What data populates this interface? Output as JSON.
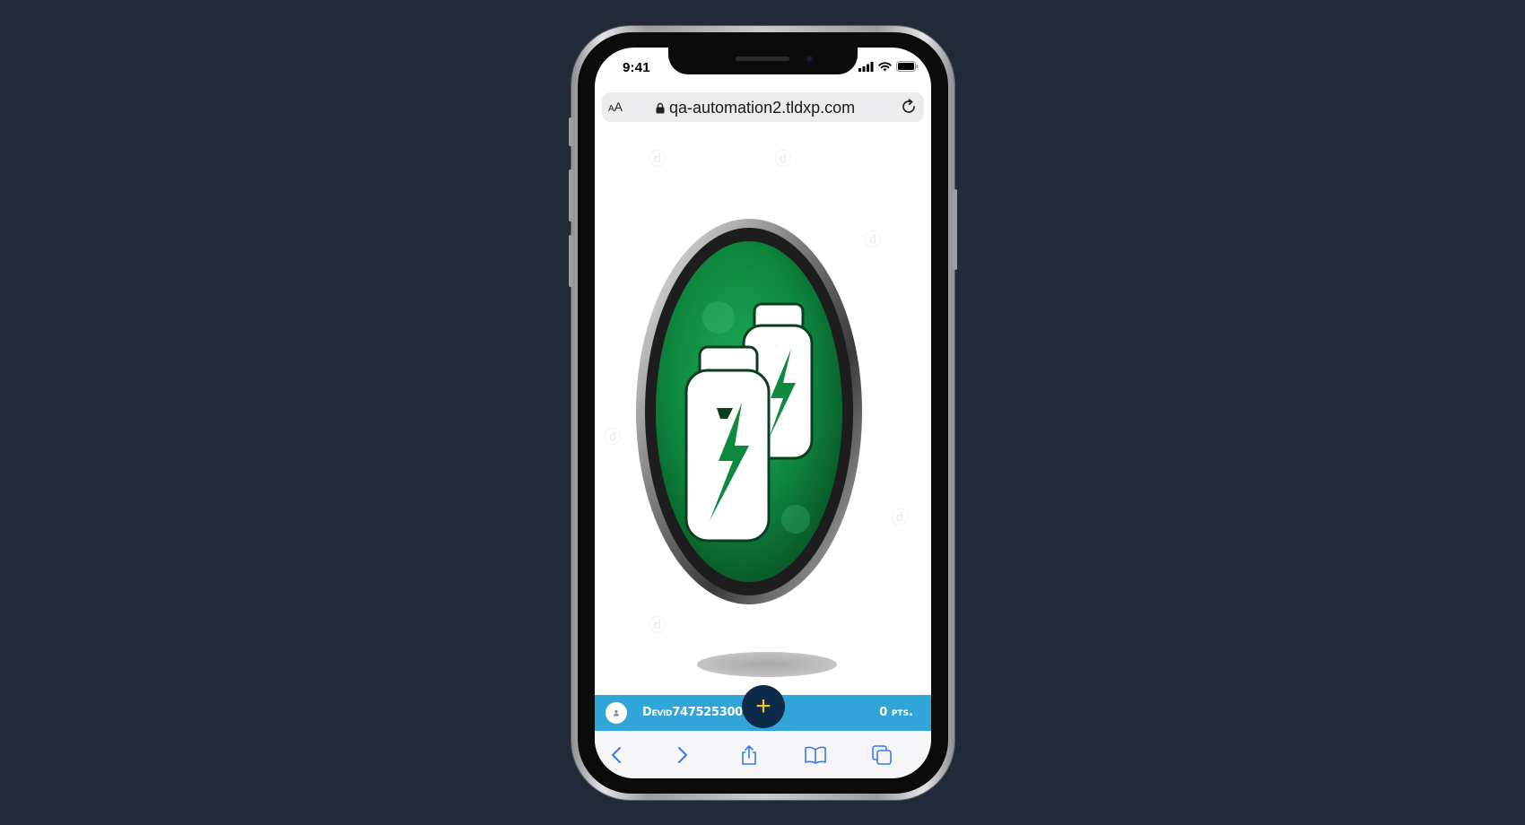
{
  "status_bar": {
    "time": "9:41"
  },
  "browser": {
    "text_size_label": "AA",
    "url": "qa-automation2.tldxp.com",
    "icons": {
      "lock": "lock-icon",
      "reload": "reload-icon"
    }
  },
  "main": {
    "logo": "energy-drink-bottles-logo"
  },
  "user_bar": {
    "username": "Devid74752530098",
    "points": "0 pts."
  },
  "fab": {
    "label": "+"
  },
  "toolbar": {
    "icons": [
      "chevron-left-icon",
      "chevron-right-icon",
      "share-icon",
      "bookmarks-icon",
      "tabs-icon"
    ]
  },
  "colors": {
    "page_background": "#222938",
    "user_bar": "#31a4d8",
    "fab": "#0d2a4b",
    "fab_plus": "#f4c21e",
    "toolbar_icon": "#3478f6",
    "logo_green": "#0e8a3f"
  }
}
